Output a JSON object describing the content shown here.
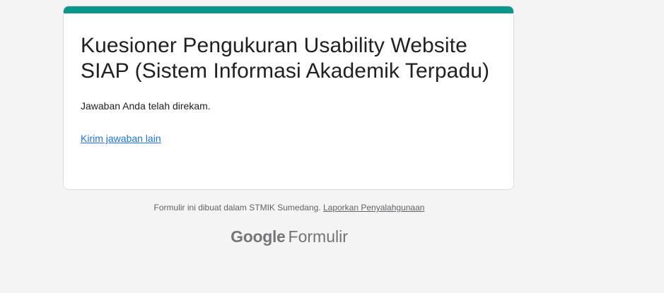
{
  "form": {
    "title": "Kuesioner Pengukuran Usability Website SIAP (Sistem Informasi Akademik Terpadu)",
    "confirmation_message": "Jawaban Anda telah direkam.",
    "resubmit_link": "Kirim jawaban lain"
  },
  "footer": {
    "created_text": "Formulir ini dibuat dalam STMIK Sumedang.",
    "report_link": "Laporkan Penyalahgunaan"
  },
  "brand": {
    "google": "Google",
    "product": "Formulir"
  },
  "colors": {
    "accent": "#0a9688",
    "link": "#1a73e8",
    "background": "#f4f4f4"
  }
}
